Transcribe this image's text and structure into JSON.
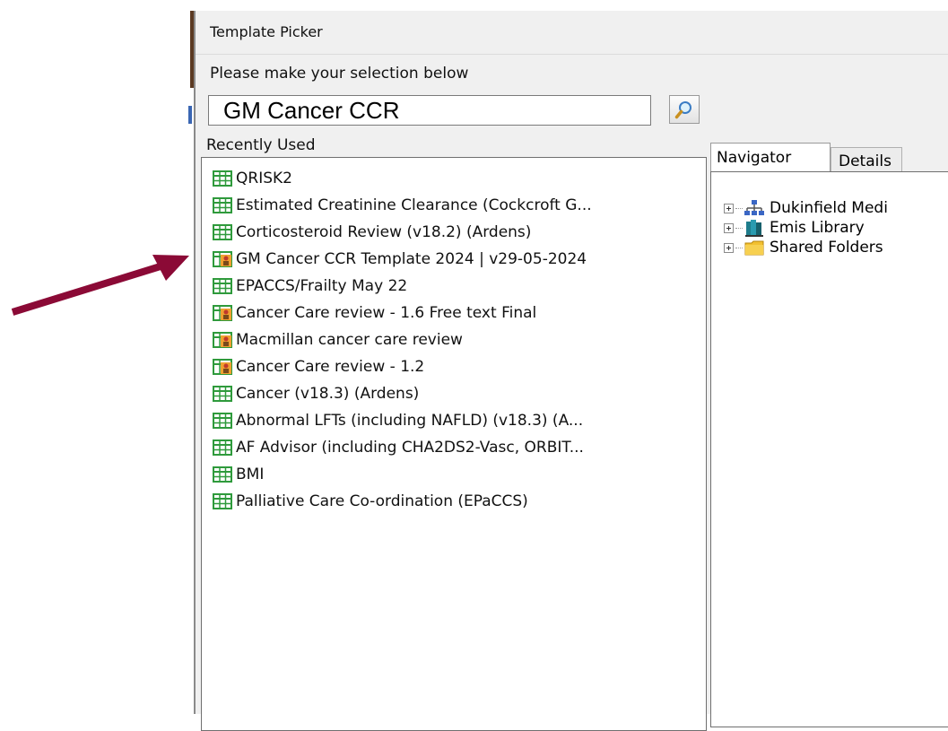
{
  "window": {
    "title": "Template Picker"
  },
  "prompt": "Please make your selection below",
  "search": {
    "value": "GM Cancer CCR",
    "button_icon": "search-icon"
  },
  "recent": {
    "label": "Recently Used",
    "items": [
      {
        "label": "QRISK2",
        "icon": "template-icon"
      },
      {
        "label": "Estimated Creatinine Clearance (Cockcroft G...",
        "icon": "template-icon"
      },
      {
        "label": "Corticosteroid Review (v18.2) (Ardens)",
        "icon": "template-icon"
      },
      {
        "label": "GM Cancer CCR Template 2024 | v29-05-2024",
        "icon": "shared-template-icon"
      },
      {
        "label": "EPACCS/Frailty May 22",
        "icon": "template-icon"
      },
      {
        "label": "Cancer Care review - 1.6 Free text Final",
        "icon": "shared-template-icon"
      },
      {
        "label": "Macmillan cancer care review",
        "icon": "shared-template-icon"
      },
      {
        "label": "Cancer Care review - 1.2",
        "icon": "shared-template-icon"
      },
      {
        "label": "Cancer (v18.3) (Ardens)",
        "icon": "template-icon"
      },
      {
        "label": "Abnormal LFTs (including NAFLD) (v18.3) (A...",
        "icon": "template-icon"
      },
      {
        "label": "AF Advisor (including CHA2DS2-Vasc, ORBIT...",
        "icon": "template-icon"
      },
      {
        "label": "BMI",
        "icon": "template-icon"
      },
      {
        "label": "Palliative Care Co-ordination (EPaCCS)",
        "icon": "template-icon"
      }
    ]
  },
  "tabs": [
    {
      "label": "Navigator",
      "selected": true
    },
    {
      "label": "Details",
      "selected": false
    }
  ],
  "navigator": {
    "items": [
      {
        "label": "Dukinfield Medi",
        "icon": "organisation-icon"
      },
      {
        "label": "Emis Library",
        "icon": "library-books-icon"
      },
      {
        "label": "Shared Folders",
        "icon": "folder-icon"
      }
    ]
  },
  "annotation": {
    "icon": "arrow-icon",
    "color": "#8b0a36"
  }
}
